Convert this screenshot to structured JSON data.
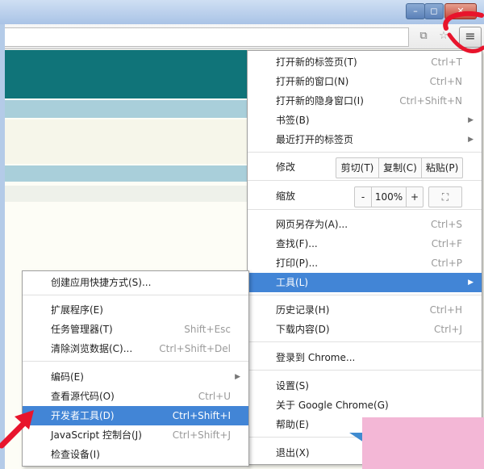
{
  "window": {
    "min_icon": "–",
    "max_icon": "◻",
    "close_icon": "✕"
  },
  "toolbar": {
    "menu_icon": "≡"
  },
  "main_menu": {
    "items_top": [
      {
        "label": "打开新的标签页(T)",
        "shortcut": "Ctrl+T"
      },
      {
        "label": "打开新的窗口(N)",
        "shortcut": "Ctrl+N"
      },
      {
        "label": "打开新的隐身窗口(I)",
        "shortcut": "Ctrl+Shift+N"
      },
      {
        "label": "书签(B)",
        "shortcut": "▶"
      },
      {
        "label": "最近打开的标签页",
        "shortcut": "▶"
      }
    ],
    "edit": {
      "label": "修改",
      "cut": "剪切(T)",
      "copy": "复制(C)",
      "paste": "粘贴(P)"
    },
    "zoom": {
      "label": "缩放",
      "minus": "-",
      "value": "100%",
      "plus": "+",
      "fullscreen": "⛶"
    },
    "items_mid": [
      {
        "label": "网页另存为(A)...",
        "shortcut": "Ctrl+S"
      },
      {
        "label": "查找(F)...",
        "shortcut": "Ctrl+F"
      },
      {
        "label": "打印(P)...",
        "shortcut": "Ctrl+P"
      },
      {
        "label": "工具(L)",
        "shortcut": "▶"
      }
    ],
    "items_hist": [
      {
        "label": "历史记录(H)",
        "shortcut": "Ctrl+H"
      },
      {
        "label": "下载内容(D)",
        "shortcut": "Ctrl+J"
      }
    ],
    "signin": "登录到 Chrome...",
    "items_bottom": [
      {
        "label": "设置(S)"
      },
      {
        "label": "关于 Google Chrome(G)"
      },
      {
        "label": "帮助(E)"
      }
    ],
    "exit": {
      "label": "退出(X)"
    }
  },
  "tools_submenu": {
    "items": [
      {
        "label": "创建应用快捷方式(S)...",
        "shortcut": ""
      },
      {
        "label": "扩展程序(E)",
        "shortcut": ""
      },
      {
        "label": "任务管理器(T)",
        "shortcut": "Shift+Esc"
      },
      {
        "label": "清除浏览数据(C)...",
        "shortcut": "Ctrl+Shift+Del"
      },
      {
        "label": "编码(E)",
        "shortcut": "▶"
      },
      {
        "label": "查看源代码(O)",
        "shortcut": "Ctrl+U"
      },
      {
        "label": "开发者工具(D)",
        "shortcut": "Ctrl+Shift+I"
      },
      {
        "label": "JavaScript 控制台(J)",
        "shortcut": "Ctrl+Shift+J"
      },
      {
        "label": "检查设备(I)",
        "shortcut": ""
      }
    ]
  },
  "colors": {
    "highlight": "#4285d6",
    "annotation": "#e8142c"
  }
}
